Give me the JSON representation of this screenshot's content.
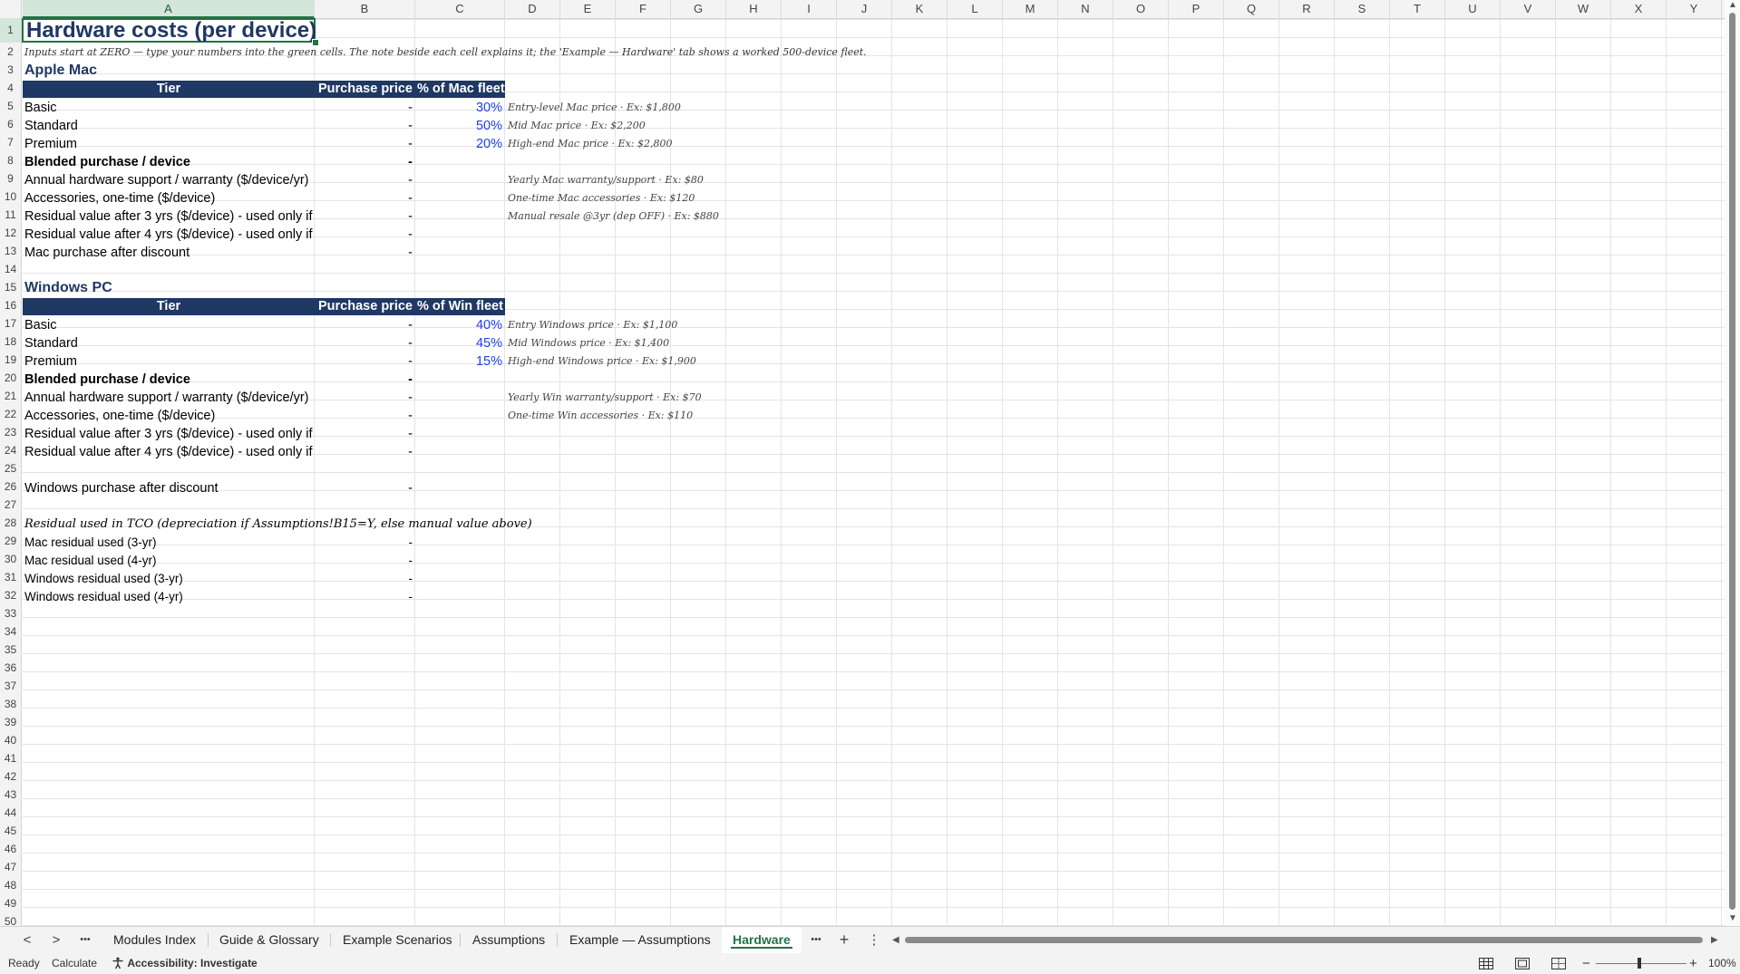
{
  "columns": [
    "A",
    "B",
    "C",
    "D",
    "E",
    "F",
    "G",
    "H",
    "I",
    "J",
    "K",
    "L",
    "M",
    "N",
    "O",
    "P",
    "Q",
    "R",
    "S",
    "T",
    "U",
    "V",
    "W",
    "X",
    "Y"
  ],
  "selected_column": "A",
  "rows": [
    "1",
    "2",
    "3",
    "4",
    "5",
    "6",
    "7",
    "8",
    "9",
    "10",
    "11",
    "12",
    "13",
    "14",
    "15",
    "16",
    "17",
    "18",
    "19",
    "20",
    "21",
    "22",
    "23",
    "24",
    "25",
    "26",
    "27",
    "28",
    "29",
    "30",
    "31",
    "32",
    "33",
    "34",
    "35",
    "36",
    "37",
    "38",
    "39",
    "40",
    "41",
    "42",
    "43",
    "44",
    "45",
    "46",
    "47",
    "48",
    "49",
    "50"
  ],
  "selected_row": "1",
  "title": "Hardware costs (per device)",
  "instructions": "Inputs start at ZERO — type your numbers into the green cells. The note beside each cell explains it; the 'Example — Hardware' tab shows a worked 500-device fleet.",
  "mac": {
    "section_title": "Apple Mac",
    "headers": {
      "tier": "Tier",
      "price": "Purchase price",
      "pct": "% of Mac fleet"
    },
    "tiers": [
      {
        "name": "Basic",
        "price": "-",
        "pct": "30%",
        "note": "Entry-level Mac price · Ex: $1,800"
      },
      {
        "name": "Standard",
        "price": "-",
        "pct": "50%",
        "note": "Mid Mac price · Ex: $2,200"
      },
      {
        "name": "Premium",
        "price": "-",
        "pct": "20%",
        "note": "High-end Mac price · Ex: $2,800"
      }
    ],
    "blended": {
      "label": "Blended purchase / device",
      "value": "-"
    },
    "support": {
      "label": "Annual hardware support / warranty ($/device/yr)",
      "value": "-",
      "note": "Yearly Mac warranty/support · Ex: $80"
    },
    "accessories": {
      "label": "Accessories, one-time ($/device)",
      "value": "-",
      "note": "One-time Mac accessories · Ex: $120"
    },
    "residual3": {
      "label": "Residual value after 3 yrs ($/device) - used only if",
      "value": "-",
      "note": "Manual resale @3yr (dep OFF) · Ex: $880"
    },
    "residual4": {
      "label": "Residual value after 4 yrs ($/device) - used only if",
      "value": "-"
    },
    "after_discount": {
      "label": "Mac purchase after discount",
      "value": "-"
    }
  },
  "win": {
    "section_title": "Windows PC",
    "headers": {
      "tier": "Tier",
      "price": "Purchase price",
      "pct": "% of Win fleet"
    },
    "tiers": [
      {
        "name": "Basic",
        "price": "-",
        "pct": "40%",
        "note": "Entry Windows price · Ex: $1,100"
      },
      {
        "name": "Standard",
        "price": "-",
        "pct": "45%",
        "note": "Mid Windows price · Ex: $1,400"
      },
      {
        "name": "Premium",
        "price": "-",
        "pct": "15%",
        "note": "High-end Windows price · Ex: $1,900"
      }
    ],
    "blended": {
      "label": "Blended purchase / device",
      "value": "-"
    },
    "support": {
      "label": "Annual hardware support / warranty ($/device/yr)",
      "value": "-",
      "note": "Yearly Win warranty/support · Ex: $70"
    },
    "accessories": {
      "label": "Accessories, one-time ($/device)",
      "value": "-",
      "note": "One-time Win accessories · Ex: $110"
    },
    "residual3": {
      "label": "Residual value after 3 yrs ($/device) - used only if",
      "value": "-"
    },
    "residual4": {
      "label": "Residual value after 4 yrs ($/device) - used only if",
      "value": "-"
    },
    "after_discount": {
      "label": "Windows purchase after discount",
      "value": "-"
    }
  },
  "residual_summary": {
    "heading": "Residual used in TCO (depreciation if Assumptions!B15=Y, else manual value above)",
    "items": [
      {
        "label": "Mac residual used (3-yr)",
        "value": "-"
      },
      {
        "label": "Mac residual used (4-yr)",
        "value": "-"
      },
      {
        "label": "Windows residual used (3-yr)",
        "value": "-"
      },
      {
        "label": "Windows residual used (4-yr)",
        "value": "-"
      }
    ]
  },
  "tabs": [
    "Modules Index",
    "Guide & Glossary",
    "Example Scenarios",
    "Assumptions",
    "Example — Assumptions",
    "Hardware"
  ],
  "active_tab": "Hardware",
  "tab_controls": {
    "more": "•••",
    "add": "+",
    "options": "⋮",
    "prev": "<",
    "next": ">",
    "scroll_left": "◀",
    "scroll_right": "▶"
  },
  "status": {
    "ready": "Ready",
    "calculate": "Calculate",
    "accessibility": "Accessibility: Investigate",
    "zoom": "100%",
    "zoom_minus": "−",
    "zoom_plus": "+"
  },
  "colors": {
    "header_fill": "#1f3864",
    "accent_green": "#217346",
    "input_blue": "#1f3df5"
  }
}
